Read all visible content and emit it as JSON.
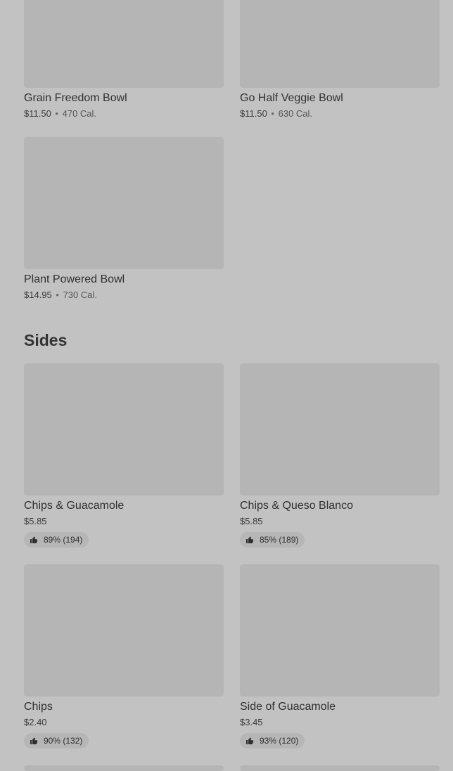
{
  "bowls": [
    {
      "name": "Grain Freedom Bowl",
      "price": "$11.50",
      "separator": "•",
      "calories": "470 Cal."
    },
    {
      "name": "Go Half Veggie Bowl",
      "price": "$11.50",
      "separator": "•",
      "calories": "630 Cal."
    },
    {
      "name": "Plant Powered Bowl",
      "price": "$14.95",
      "separator": "•",
      "calories": "730 Cal."
    }
  ],
  "sides_section": {
    "title": "Sides"
  },
  "sides": [
    {
      "name": "Chips & Guacamole",
      "price": "$5.85",
      "rating": "89% (194)"
    },
    {
      "name": "Chips & Queso Blanco",
      "price": "$5.85",
      "rating": "85% (189)"
    },
    {
      "name": "Chips",
      "price": "$2.40",
      "rating": "90% (132)"
    },
    {
      "name": "Side of Guacamole",
      "price": "$3.45",
      "rating": "93% (120)"
    }
  ],
  "icons": {
    "rating": "thumbs-up-icon"
  },
  "colors": {
    "background": "#c2c2c2",
    "image_placeholder": "#b5b5b5",
    "rating_pill": "#b6b6b6"
  }
}
